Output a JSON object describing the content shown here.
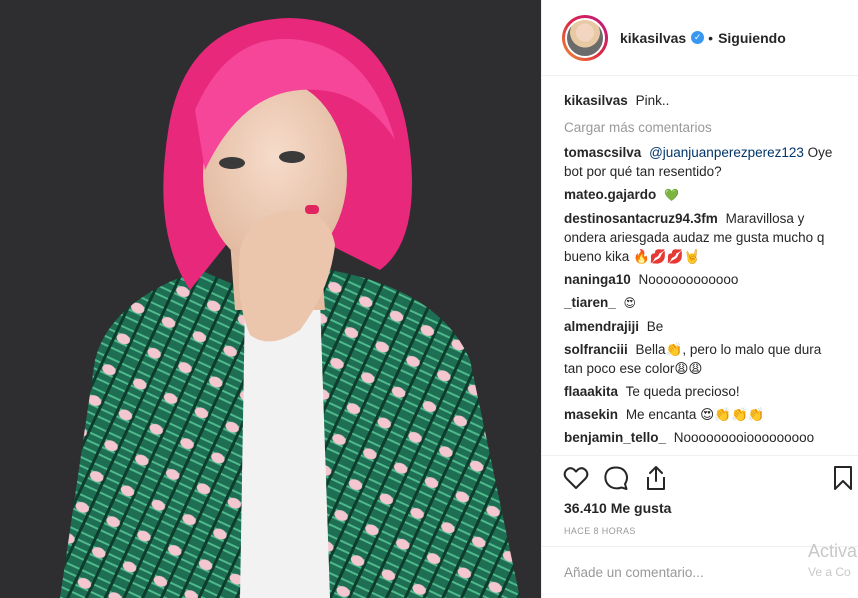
{
  "post": {
    "username": "kikasilvas",
    "verified_badge": "✓",
    "separator": "•",
    "follow_status": "Siguiendo",
    "caption": "Pink..",
    "load_more": "Cargar más comentarios",
    "likes": "36.410 Me gusta",
    "time": "HACE 8 HORAS",
    "add_comment_placeholder": "Añade un comentario...",
    "watermark_line1": "Activa",
    "watermark_line2": "Ve a Co"
  },
  "comments": [
    {
      "user": "tomascsilva",
      "mention": "@juanjuanperezperez123",
      "text": "Oye bot por qué tan resentido?"
    },
    {
      "user": "mateo.gajardo",
      "text": "💚"
    },
    {
      "user": "destinosantacruz94.3fm",
      "text": "Maravillosa y ondera ariesgada audaz me gusta mucho q bueno kika 🔥💋💋🤘"
    },
    {
      "user": "naninga10",
      "text": "Noooooooooooo"
    },
    {
      "user": "_tiaren_",
      "text": "😍"
    },
    {
      "user": "almendrajiji",
      "text": "Be"
    },
    {
      "user": "solfranciii",
      "text": "Bella👏, pero lo malo que dura tan poco ese color😩😩"
    },
    {
      "user": "flaaakita",
      "text": "Te queda precioso!"
    },
    {
      "user": "masekin",
      "text": "Me encanta 😍👏👏👏"
    },
    {
      "user": "benjamin_tello_",
      "text": "Nooooooooiooooooooo"
    },
    {
      "user": "",
      "text": "😮😮😮😮😮"
    }
  ],
  "icons": {
    "like": "heart-icon",
    "comment": "comment-icon",
    "share": "share-icon",
    "save": "bookmark-icon"
  },
  "colors": {
    "text": "#262626",
    "muted": "#999999",
    "mention": "#003569",
    "verified": "#3897f0",
    "hair": "#f0327f",
    "jacket": "#1f7a5a"
  }
}
